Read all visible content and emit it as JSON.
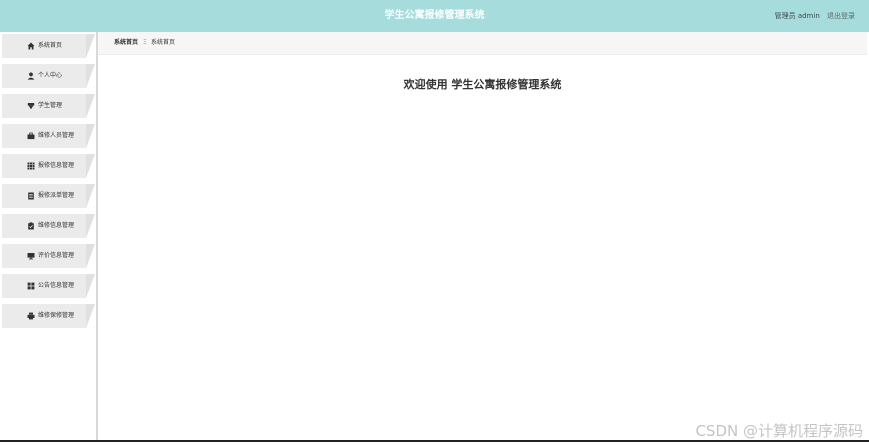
{
  "header": {
    "title": "学生公寓报修管理系统",
    "role_label": "管理员",
    "username": "admin",
    "logout_label": "退出登录"
  },
  "sidebar": {
    "items": [
      {
        "label": "系统首页",
        "icon": "home-icon"
      },
      {
        "label": "个人中心",
        "icon": "user-icon"
      },
      {
        "label": "学生管理",
        "icon": "student-icon"
      },
      {
        "label": "维修人员管理",
        "icon": "briefcase-icon"
      },
      {
        "label": "报修信息管理",
        "icon": "grid-icon"
      },
      {
        "label": "报修派单管理",
        "icon": "document-icon"
      },
      {
        "label": "维修信息管理",
        "icon": "clipboard-icon"
      },
      {
        "label": "评价信息管理",
        "icon": "monitor-icon"
      },
      {
        "label": "公告信息管理",
        "icon": "apps-icon"
      },
      {
        "label": "维修保修管理",
        "icon": "printer-icon"
      }
    ]
  },
  "breadcrumb": {
    "root": "系统首页",
    "separator": "Ξ",
    "current": "系统首页"
  },
  "main": {
    "welcome": "欢迎使用 学生公寓报修管理系统"
  },
  "watermark": "CSDN @计算机程序源码",
  "colors": {
    "header_bg": "#a6dcdc",
    "menu_bg": "#ebebeb",
    "text": "#333333"
  }
}
